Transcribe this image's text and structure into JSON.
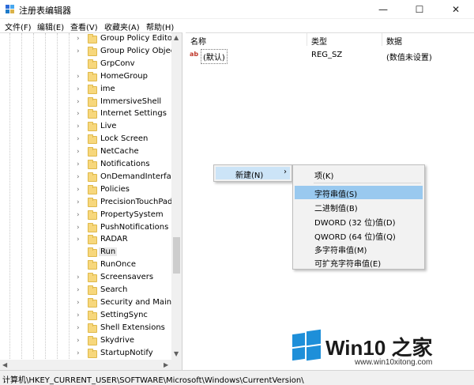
{
  "window": {
    "title": "注册表编辑器",
    "min_glyph": "—",
    "max_glyph": "☐",
    "close_glyph": "✕"
  },
  "menu": [
    "文件(F)",
    "编辑(E)",
    "查看(V)",
    "收藏夹(A)",
    "帮助(H)"
  ],
  "tree": {
    "items": [
      {
        "label": "Group Policy Editor",
        "expandable": true
      },
      {
        "label": "Group Policy Objec",
        "expandable": true
      },
      {
        "label": "GrpConv",
        "expandable": false
      },
      {
        "label": "HomeGroup",
        "expandable": true
      },
      {
        "label": "ime",
        "expandable": true
      },
      {
        "label": "ImmersiveShell",
        "expandable": true
      },
      {
        "label": "Internet Settings",
        "expandable": true
      },
      {
        "label": "Live",
        "expandable": true
      },
      {
        "label": "Lock Screen",
        "expandable": true
      },
      {
        "label": "NetCache",
        "expandable": true
      },
      {
        "label": "Notifications",
        "expandable": true
      },
      {
        "label": "OnDemandInterface",
        "expandable": true
      },
      {
        "label": "Policies",
        "expandable": true
      },
      {
        "label": "PrecisionTouchPad",
        "expandable": true
      },
      {
        "label": "PropertySystem",
        "expandable": true
      },
      {
        "label": "PushNotifications",
        "expandable": true
      },
      {
        "label": "RADAR",
        "expandable": true
      },
      {
        "label": "Run",
        "expandable": false,
        "selected": true
      },
      {
        "label": "RunOnce",
        "expandable": false
      },
      {
        "label": "Screensavers",
        "expandable": true
      },
      {
        "label": "Search",
        "expandable": true
      },
      {
        "label": "Security and Mainte",
        "expandable": true
      },
      {
        "label": "SettingSync",
        "expandable": true
      },
      {
        "label": "Shell Extensions",
        "expandable": true
      },
      {
        "label": "Skydrive",
        "expandable": true
      },
      {
        "label": "StartupNotify",
        "expandable": true
      }
    ]
  },
  "list": {
    "columns": [
      "名称",
      "类型",
      "数据"
    ],
    "rows": [
      {
        "icon": "ab",
        "name": "(默认)",
        "type": "REG_SZ",
        "data": "(数值未设置)"
      }
    ]
  },
  "context_menu": {
    "new_label": "新建(N)",
    "submenu_arrow": "›",
    "submenu": [
      "项(K)",
      "字符串值(S)",
      "二进制值(B)",
      "DWORD (32 位)值(D)",
      "QWORD (64 位)值(Q)",
      "多字符串值(M)",
      "可扩充字符串值(E)"
    ],
    "highlighted_index": 1
  },
  "status": {
    "path": "计算机\\HKEY_CURRENT_USER\\SOFTWARE\\Microsoft\\Windows\\CurrentVersion\\"
  },
  "watermark": {
    "title": "Win10 之家",
    "url": "www.win10xitong.com",
    "color": "#1e8fd9"
  },
  "colors": {
    "selection": "#cce4f7",
    "submenu_highlight": "#99c9ef",
    "folder": "#f7d77c"
  }
}
